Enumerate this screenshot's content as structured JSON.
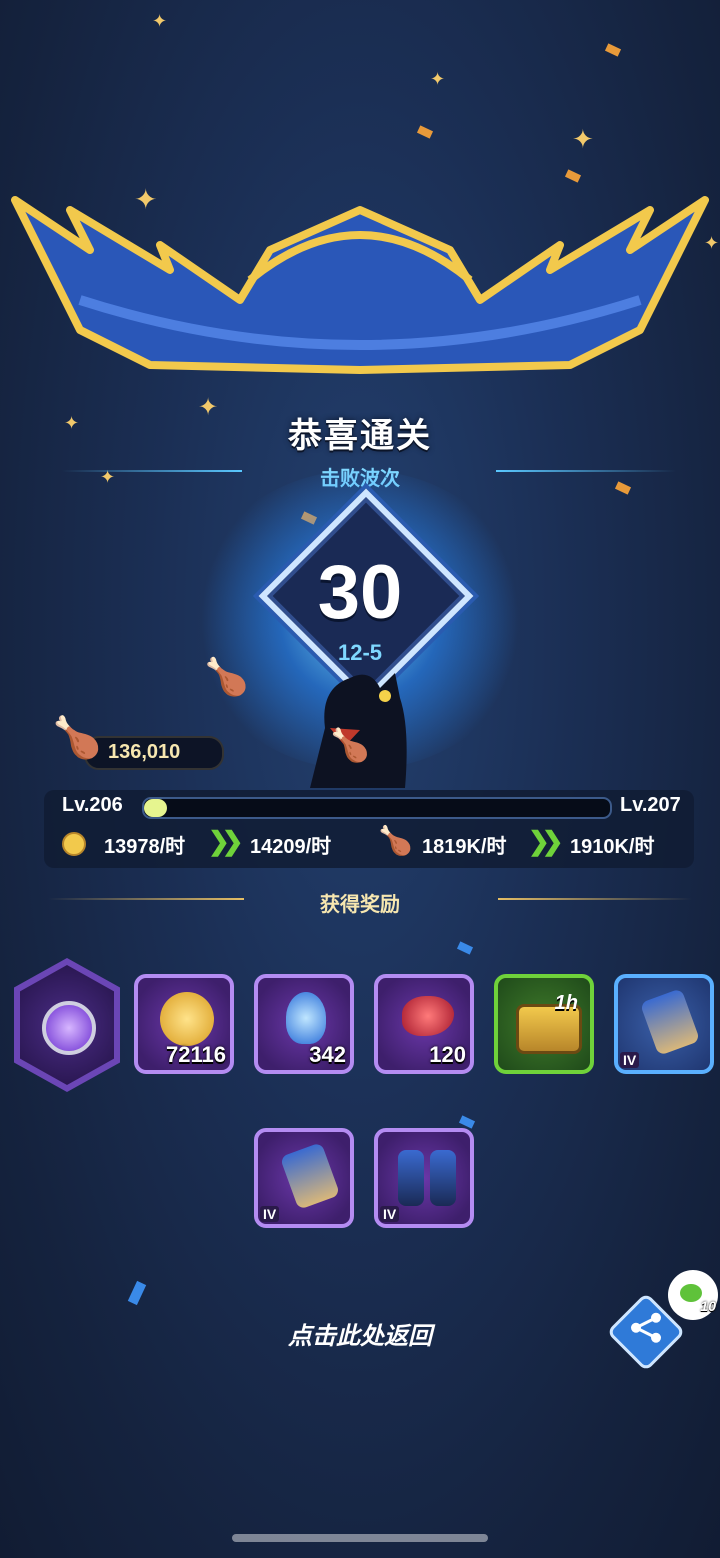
{
  "header": {
    "title": "恭喜通关",
    "subtitle": "击败波次"
  },
  "wave": {
    "number": "30",
    "stage": "12-5"
  },
  "food_counter": "136,010",
  "level": {
    "current": "Lv.206",
    "next": "Lv.207",
    "progress_fraction": 0.05
  },
  "rates": {
    "gold_current": "13978/时",
    "gold_next": "14209/时",
    "food_current": "1819K/时",
    "food_next": "1910K/时"
  },
  "rewards": {
    "title": "获得奖励",
    "items": [
      {
        "name": "amulet",
        "count": ""
      },
      {
        "name": "gold-coins",
        "count": "72116"
      },
      {
        "name": "blue-crystal",
        "count": "342"
      },
      {
        "name": "red-bean",
        "count": "120"
      },
      {
        "name": "treasure-chest",
        "count": "1h"
      },
      {
        "name": "gauntlet",
        "tier": "IV"
      },
      {
        "name": "gauntlet",
        "tier": "IV"
      },
      {
        "name": "boots",
        "tier": "IV"
      }
    ]
  },
  "footer": {
    "return_label": "点击此处返回",
    "bubble_count": "10"
  },
  "colors": {
    "accent_cyan": "#7fd8ff",
    "gold": "#e6be64",
    "purple_frame": "#b48cf2",
    "green_frame": "#6fd23a",
    "blue_frame": "#5ab0ff"
  }
}
